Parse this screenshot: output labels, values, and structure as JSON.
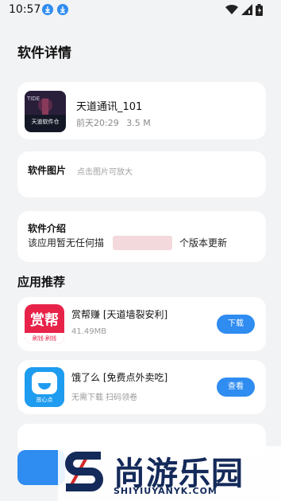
{
  "status_bar": {
    "time": "10:57"
  },
  "page": {
    "title": "软件详情"
  },
  "app": {
    "name": "天道通讯_101",
    "date": "前天20:29",
    "size": "3.5 M",
    "icon_text": "天道软件仓"
  },
  "screenshots": {
    "label": "软件图片",
    "hint": "点击图片可放大"
  },
  "intro": {
    "label": "软件介绍",
    "text_start": "该应用暂无任何描",
    "text_end": "个版本更新"
  },
  "recommend": {
    "title": "应用推荐",
    "items": [
      {
        "name": "赏帮赚 [天道墙裂安利]",
        "sub": "41.49MB",
        "button": "下载",
        "icon_text": "赏帮",
        "icon_caption": "刷钱·刷钱"
      },
      {
        "name": "饿了么 [免费点外卖吃]",
        "sub": "无需下载 扫码领卷",
        "button": "查看",
        "icon_caption": "放心点"
      }
    ]
  },
  "watermark": {
    "text": "尚游乐园",
    "url": "SHIYIUYANYK.COM"
  },
  "colors": {
    "accent": "#2f8cf0",
    "background": "#f2f3f5"
  }
}
